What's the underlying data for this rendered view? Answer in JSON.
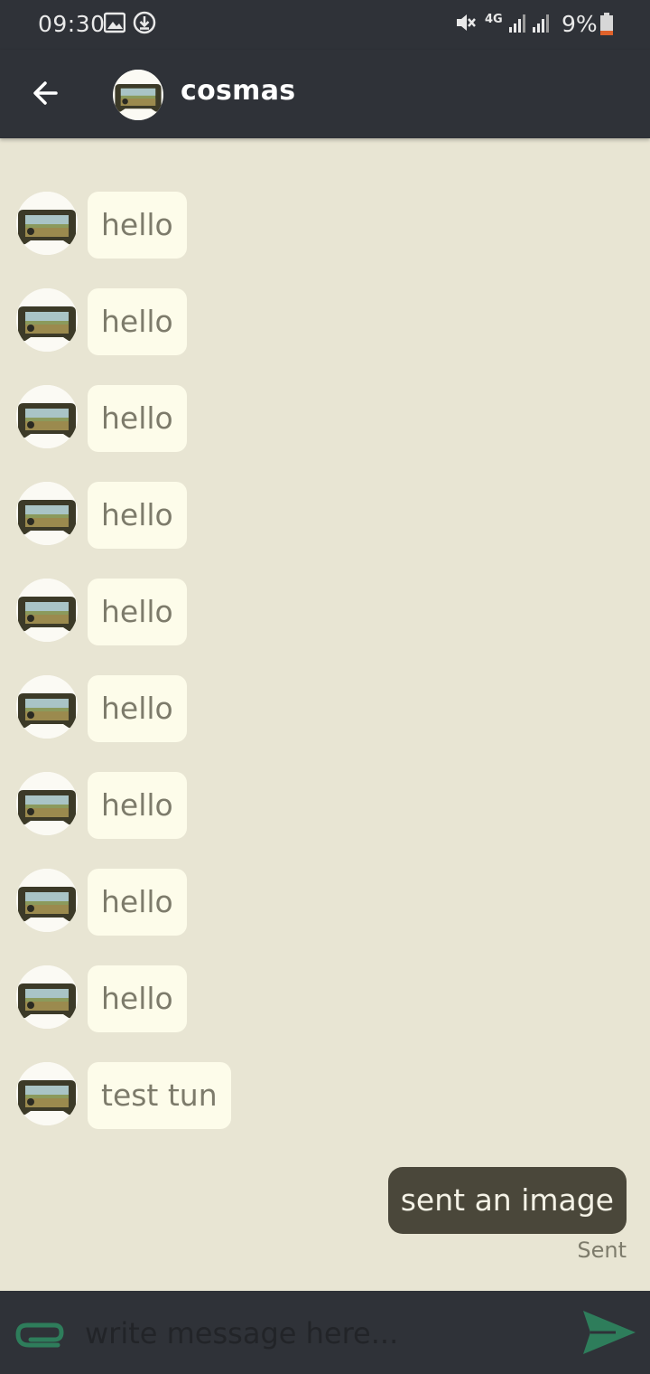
{
  "status_bar": {
    "time": "09:30",
    "battery": "9%",
    "network": "4G",
    "icons": [
      "image-icon",
      "download-icon",
      "mute-icon",
      "signal-icon",
      "battery-icon"
    ]
  },
  "header": {
    "contact_name": "cosmas"
  },
  "messages": [
    {
      "text": "hello"
    },
    {
      "text": "hello"
    },
    {
      "text": "hello"
    },
    {
      "text": "hello"
    },
    {
      "text": "hello"
    },
    {
      "text": "hello"
    },
    {
      "text": "hello"
    },
    {
      "text": "hello"
    },
    {
      "text": "hello"
    },
    {
      "text": "test tun"
    }
  ],
  "outgoing": {
    "text": "sent an image",
    "status": "Sent"
  },
  "composer": {
    "placeholder": "write message here..."
  },
  "colors": {
    "bar": "#2f3238",
    "background": "#e8e5d3",
    "incoming_bubble": "#fdfcea",
    "outgoing_bubble": "#4a473a",
    "accent": "#2e7d5b"
  }
}
